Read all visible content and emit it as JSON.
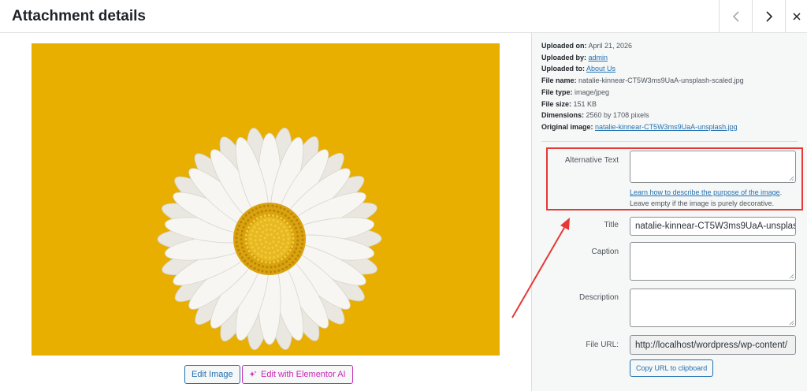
{
  "header": {
    "title": "Attachment details"
  },
  "image": {
    "alt": "White daisy on yellow background"
  },
  "buttons": {
    "edit_image": "Edit Image",
    "edit_elementor": "Edit with Elementor AI"
  },
  "details": {
    "uploaded_on_label": "Uploaded on:",
    "uploaded_on": "April 21, 2026",
    "uploaded_by_label": "Uploaded by:",
    "uploaded_by": "admin",
    "uploaded_to_label": "Uploaded to:",
    "uploaded_to": "About Us",
    "file_name_label": "File name:",
    "file_name": "natalie-kinnear-CT5W3ms9UaA-unsplash-scaled.jpg",
    "file_type_label": "File type:",
    "file_type": "image/jpeg",
    "file_size_label": "File size:",
    "file_size": "151 KB",
    "dimensions_label": "Dimensions:",
    "dimensions": "2560 by 1708 pixels",
    "original_image_label": "Original image:",
    "original_image": "natalie-kinnear-CT5W3ms9UaA-unsplash.jpg"
  },
  "fields": {
    "alt_label": "Alternative Text",
    "alt_value": "",
    "alt_help_link": "Learn how to describe the purpose of the image",
    "alt_help_period": ".",
    "alt_help_text": "Leave empty if the image is purely decorative.",
    "title_label": "Title",
    "title_value": "natalie-kinnear-CT5W3ms9UaA-unsplas",
    "caption_label": "Caption",
    "caption_value": "",
    "description_label": "Description",
    "description_value": "",
    "file_url_label": "File URL:",
    "file_url_value": "http://localhost/wordpress/wp-content/",
    "copy_url": "Copy URL to clipboard"
  },
  "colors": {
    "accent": "#2271b1",
    "elementor": "#c929b8",
    "highlight": "#e53935",
    "image_bg": "#e8ae00"
  }
}
